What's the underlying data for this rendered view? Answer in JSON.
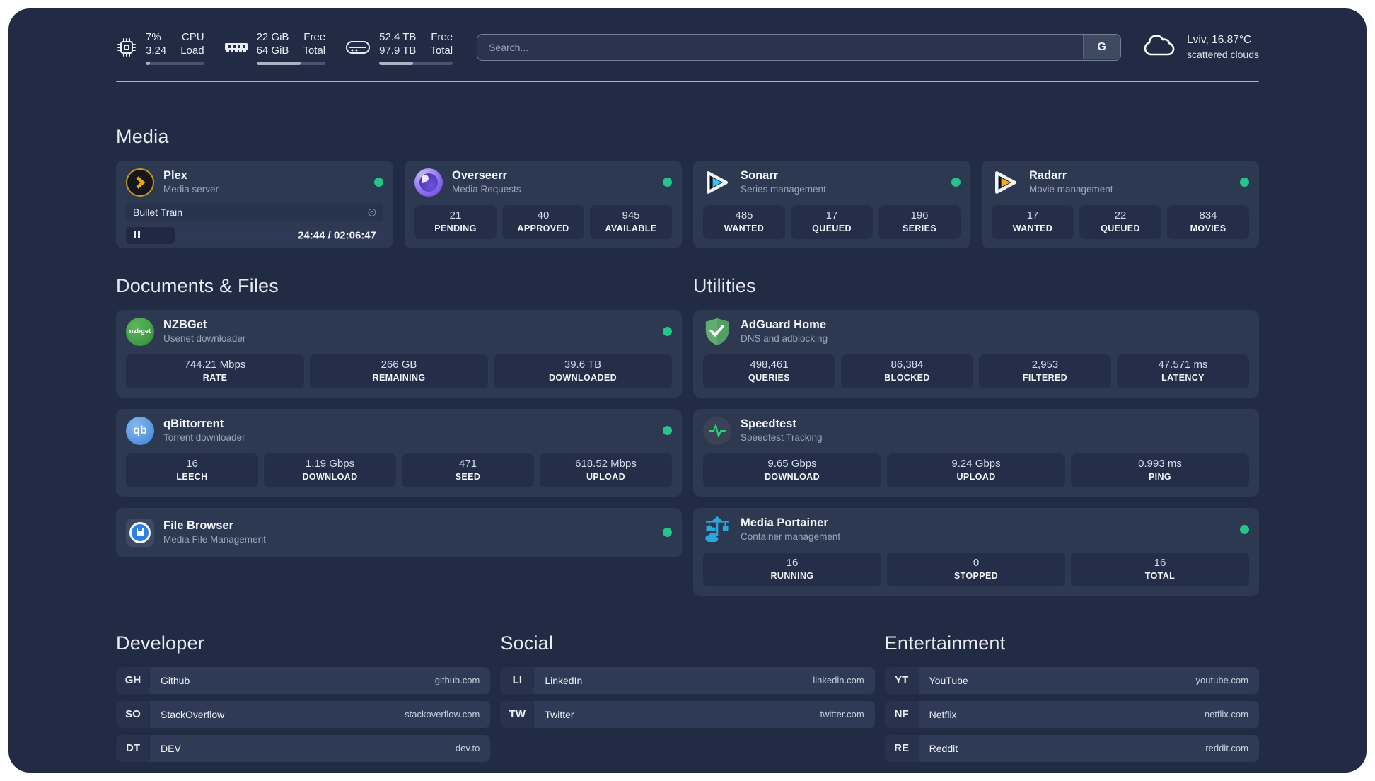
{
  "header": {
    "stats": [
      {
        "icon": "cpu-icon",
        "value_top": "7%",
        "value_bottom": "3.24",
        "label_top": "CPU",
        "label_bottom": "Load",
        "progress_style": "width:7%"
      },
      {
        "icon": "memory-icon",
        "value_top": "22 GiB",
        "value_bottom": "64 GiB",
        "label_top": "Free",
        "label_bottom": "Total",
        "progress_style": "width:64%"
      },
      {
        "icon": "storage-icon",
        "value_top": "52.4 TB",
        "value_bottom": "97.9 TB",
        "label_top": "Free",
        "label_bottom": "Total",
        "progress_style": "width:46%"
      }
    ],
    "search": {
      "placeholder": "Search...",
      "provider_button": "G"
    },
    "weather": {
      "location_temp": "Lviv, 16.87°C",
      "condition": "scattered clouds"
    }
  },
  "sections": {
    "media": {
      "title": "Media"
    },
    "documents": {
      "title": "Documents & Files"
    },
    "utilities": {
      "title": "Utilities"
    },
    "developer": {
      "title": "Developer"
    },
    "social": {
      "title": "Social"
    },
    "entertainment": {
      "title": "Entertainment"
    }
  },
  "icons": {
    "nzbget_text": "nzbget",
    "qbittorrent_text": "qb"
  },
  "colors": {
    "status_online": "#27c489",
    "panel_bg": "#222b44",
    "card_bg": "#2d3950",
    "tile_bg": "#242e48",
    "plex_accent": "#e5a00d",
    "sonarr_accent": "#35c5f4",
    "radarr_accent": "#f6a723"
  },
  "media_cards": [
    {
      "icon": "plex-icon",
      "name": "Plex",
      "description": "Media server",
      "status": "online",
      "player": {
        "title": "Bullet Train",
        "time": "24:44 / 02:06:47",
        "progress_style": "width:19%"
      }
    },
    {
      "icon": "overseerr-icon",
      "name": "Overseerr",
      "description": "Media Requests",
      "status": "online",
      "stats": [
        {
          "value": "21",
          "label": "PENDING"
        },
        {
          "value": "40",
          "label": "APPROVED"
        },
        {
          "value": "945",
          "label": "AVAILABLE"
        }
      ]
    },
    {
      "icon": "sonarr-icon",
      "name": "Sonarr",
      "description": "Series management",
      "status": "online",
      "stats": [
        {
          "value": "485",
          "label": "WANTED"
        },
        {
          "value": "17",
          "label": "QUEUED"
        },
        {
          "value": "196",
          "label": "SERIES"
        }
      ]
    },
    {
      "icon": "radarr-icon",
      "name": "Radarr",
      "description": "Movie management",
      "status": "online",
      "stats": [
        {
          "value": "17",
          "label": "WANTED"
        },
        {
          "value": "22",
          "label": "QUEUED"
        },
        {
          "value": "834",
          "label": "MOVIES"
        }
      ]
    }
  ],
  "documents_cards": [
    {
      "icon": "nzbget-icon",
      "name": "NZBGet",
      "description": "Usenet downloader",
      "status": "online",
      "stats": [
        {
          "value": "744.21 Mbps",
          "label": "RATE"
        },
        {
          "value": "266 GB",
          "label": "REMAINING"
        },
        {
          "value": "39.6 TB",
          "label": "DOWNLOADED"
        }
      ]
    },
    {
      "icon": "qbittorrent-icon",
      "name": "qBittorrent",
      "description": "Torrent downloader",
      "status": "online",
      "stats": [
        {
          "value": "16",
          "label": "LEECH"
        },
        {
          "value": "1.19 Gbps",
          "label": "DOWNLOAD"
        },
        {
          "value": "471",
          "label": "SEED"
        },
        {
          "value": "618.52 Mbps",
          "label": "UPLOAD"
        }
      ]
    },
    {
      "icon": "filebrowser-icon",
      "name": "File Browser",
      "description": "Media File Management",
      "status": "online"
    }
  ],
  "utilities_cards": [
    {
      "icon": "adguard-icon",
      "name": "AdGuard Home",
      "description": "DNS and adblocking",
      "stats": [
        {
          "value": "498,461",
          "label": "QUERIES"
        },
        {
          "value": "86,384",
          "label": "BLOCKED"
        },
        {
          "value": "2,953",
          "label": "FILTERED"
        },
        {
          "value": "47.571 ms",
          "label": "LATENCY"
        }
      ]
    },
    {
      "icon": "speedtest-icon",
      "name": "Speedtest",
      "description": "Speedtest Tracking",
      "stats": [
        {
          "value": "9.65 Gbps",
          "label": "DOWNLOAD"
        },
        {
          "value": "9.24 Gbps",
          "label": "UPLOAD"
        },
        {
          "value": "0.993 ms",
          "label": "PING"
        }
      ]
    },
    {
      "icon": "portainer-icon",
      "name": "Media Portainer",
      "description": "Container management",
      "status": "online",
      "stats": [
        {
          "value": "16",
          "label": "RUNNING"
        },
        {
          "value": "0",
          "label": "STOPPED"
        },
        {
          "value": "16",
          "label": "TOTAL"
        }
      ]
    }
  ],
  "links": {
    "developer": [
      {
        "abbr": "GH",
        "name": "Github",
        "url": "github.com"
      },
      {
        "abbr": "SO",
        "name": "StackOverflow",
        "url": "stackoverflow.com"
      },
      {
        "abbr": "DT",
        "name": "DEV",
        "url": "dev.to"
      }
    ],
    "social": [
      {
        "abbr": "LI",
        "name": "LinkedIn",
        "url": "linkedin.com"
      },
      {
        "abbr": "TW",
        "name": "Twitter",
        "url": "twitter.com"
      }
    ],
    "entertainment": [
      {
        "abbr": "YT",
        "name": "YouTube",
        "url": "youtube.com"
      },
      {
        "abbr": "NF",
        "name": "Netflix",
        "url": "netflix.com"
      },
      {
        "abbr": "RE",
        "name": "Reddit",
        "url": "reddit.com"
      }
    ]
  }
}
